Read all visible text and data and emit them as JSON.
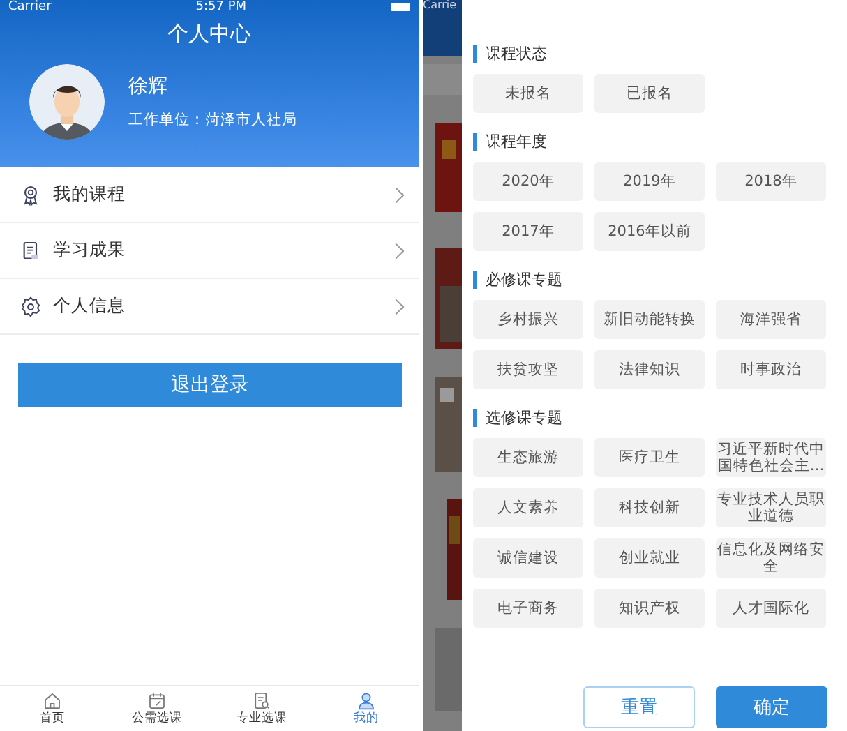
{
  "left_screen": {
    "status_bar": {
      "carrier": "Carrier",
      "time": "5:57 PM"
    },
    "title": "个人中心",
    "profile": {
      "name": "徐辉",
      "unit": "工作单位：菏泽市人社局"
    },
    "menu": [
      {
        "label": "我的课程"
      },
      {
        "label": "学习成果"
      },
      {
        "label": "个人信息"
      }
    ],
    "logout_button": "退出登录",
    "tab_bar": [
      {
        "label": "首页",
        "selected": false
      },
      {
        "label": "公需选课",
        "selected": false
      },
      {
        "label": "专业选课",
        "selected": false
      },
      {
        "label": "我的",
        "selected": true
      }
    ]
  },
  "right_screen": {
    "status_bar": {
      "carrier": "Carrie"
    },
    "filter_sections": [
      {
        "title": "课程状态",
        "options": [
          {
            "label": "未报名",
            "selected": false
          },
          {
            "label": "已报名",
            "selected": false
          }
        ]
      },
      {
        "title": "课程年度",
        "options": [
          {
            "label": "2020年",
            "selected": false
          },
          {
            "label": "2019年",
            "selected": false
          },
          {
            "label": "2018年",
            "selected": false
          },
          {
            "label": "2017年",
            "selected": false
          },
          {
            "label": "2016年以前",
            "selected": false
          }
        ]
      },
      {
        "title": "必修课专题",
        "options": [
          {
            "label": "乡村振兴",
            "selected": false
          },
          {
            "label": "新旧动能转换",
            "selected": false
          },
          {
            "label": "海洋强省",
            "selected": false
          },
          {
            "label": "扶贫攻坚",
            "selected": false
          },
          {
            "label": "法律知识",
            "selected": false
          },
          {
            "label": "时事政治",
            "selected": false
          }
        ]
      },
      {
        "title": "选修课专题",
        "options": [
          {
            "label": "生态旅游",
            "selected": false
          },
          {
            "label": "医疗卫生",
            "selected": false
          },
          {
            "label": "习近平新时代中国特色社会主…",
            "selected": false
          },
          {
            "label": "人文素养",
            "selected": false
          },
          {
            "label": "科技创新",
            "selected": false
          },
          {
            "label": "专业技术人员职业道德",
            "selected": false
          },
          {
            "label": "诚信建设",
            "selected": false
          },
          {
            "label": "创业就业",
            "selected": false
          },
          {
            "label": "信息化及网络安全",
            "selected": false
          },
          {
            "label": "电子商务",
            "selected": false
          },
          {
            "label": "知识产权",
            "selected": false
          },
          {
            "label": "人才国际化",
            "selected": false
          }
        ]
      }
    ],
    "reset_button": "重置",
    "confirm_button": "确定"
  }
}
